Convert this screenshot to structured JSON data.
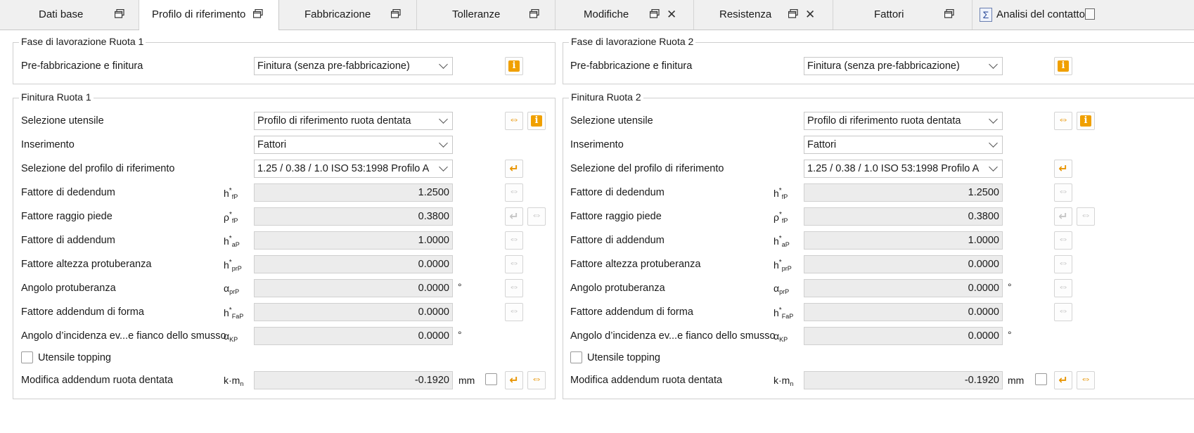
{
  "tabs": {
    "dati_base": "Dati base",
    "profilo": "Profilo di riferimento",
    "fabbricazione": "Fabbricazione",
    "tolleranze": "Tolleranze",
    "modifiche": "Modifiche",
    "resistenza": "Resistenza",
    "fattori": "Fattori",
    "analisi": "Analisi del contatto",
    "close_glyph": "✕",
    "calc_glyph": "Σ"
  },
  "info_glyph": "i",
  "arrow_lr": "⇔",
  "arrow_back": "↵",
  "wheel1": {
    "fase_title": "Fase di lavorazione Ruota 1",
    "finitura_title": "Finitura Ruota 1",
    "pre_label": "Pre-fabbricazione e finitura",
    "pre_value": "Finitura (senza pre-fabbricazione)",
    "sel_utensile_label": "Selezione utensile",
    "sel_utensile_value": "Profilo di riferimento ruota dentata",
    "inserimento_label": "Inserimento",
    "inserimento_value": "Fattori",
    "sel_profilo_label": "Selezione del profilo di riferimento",
    "sel_profilo_value": "1.25 / 0.38 / 1.0 ISO 53:1998 Profilo A",
    "dedendum_label": "Fattore di dedendum",
    "dedendum_value": "1.2500",
    "raggio_label": "Fattore raggio piede",
    "raggio_value": "0.3800",
    "addendum_label": "Fattore di addendum",
    "addendum_value": "1.0000",
    "protub_label": "Fattore altezza protuberanza",
    "protub_value": "0.0000",
    "angolo_protub_label": "Angolo protuberanza",
    "angolo_protub_value": "0.0000",
    "forma_label": "Fattore addendum di forma",
    "forma_value": "0.0000",
    "incidenza_label": "Angolo d’incidenza ev...e fianco dello smusso",
    "incidenza_value": "0.0000",
    "topping_label": "Utensile topping",
    "mod_addendum_label": "Modifica addendum ruota dentata",
    "mod_addendum_value": "-0.1920",
    "unit_deg": "°",
    "unit_mm": "mm"
  },
  "wheel2": {
    "fase_title": "Fase di lavorazione Ruota 2",
    "finitura_title": "Finitura Ruota 2",
    "pre_label": "Pre-fabbricazione e finitura",
    "pre_value": "Finitura (senza pre-fabbricazione)",
    "sel_utensile_label": "Selezione utensile",
    "sel_utensile_value": "Profilo di riferimento ruota dentata",
    "inserimento_label": "Inserimento",
    "inserimento_value": "Fattori",
    "sel_profilo_label": "Selezione del profilo di riferimento",
    "sel_profilo_value": "1.25 / 0.38 / 1.0 ISO 53:1998 Profilo A",
    "dedendum_label": "Fattore di dedendum",
    "dedendum_value": "1.2500",
    "raggio_label": "Fattore raggio piede",
    "raggio_value": "0.3800",
    "addendum_label": "Fattore di addendum",
    "addendum_value": "1.0000",
    "protub_label": "Fattore altezza protuberanza",
    "protub_value": "0.0000",
    "angolo_protub_label": "Angolo protuberanza",
    "angolo_protub_value": "0.0000",
    "forma_label": "Fattore addendum di forma",
    "forma_value": "0.0000",
    "incidenza_label": "Angolo d’incidenza ev...e fianco dello smusso",
    "incidenza_value": "0.0000",
    "topping_label": "Utensile topping",
    "mod_addendum_label": "Modifica addendum ruota dentata",
    "mod_addendum_value": "-0.1920",
    "unit_deg": "°",
    "unit_mm": "mm"
  },
  "symbols": {
    "h": "h",
    "rho": "ρ",
    "alpha": "α",
    "star": "*",
    "fP": "fP",
    "aP": "aP",
    "prP": "prP",
    "FaP": "FaP",
    "KP": "KP",
    "k_m": "k·m",
    "n": "n"
  }
}
